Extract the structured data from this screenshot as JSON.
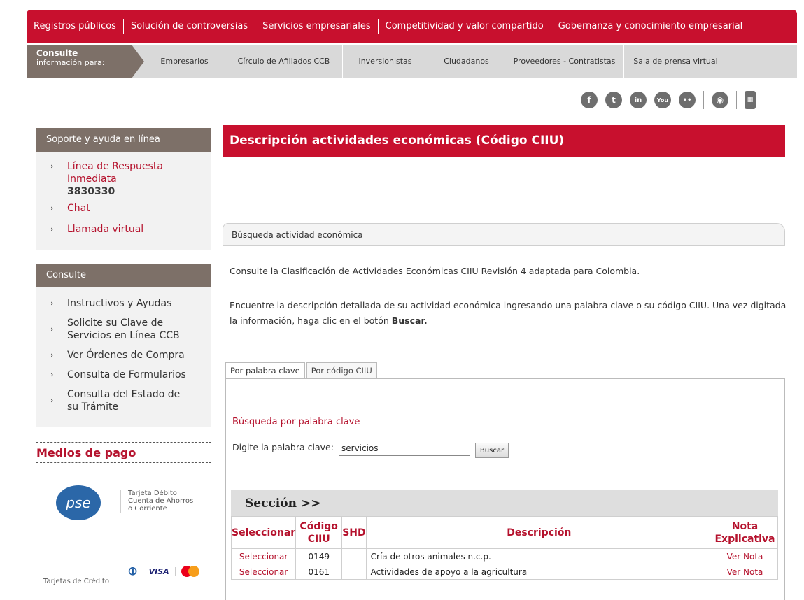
{
  "top_nav": [
    "Registros públicos",
    "Solución de controversias",
    "Servicios empresariales",
    "Competitividad y valor compartido",
    "Gobernanza y conocimiento empresarial"
  ],
  "sub_nav": {
    "consulte_title": "Consulte",
    "consulte_subtitle": "información para:",
    "items": [
      "Empresarios",
      "Círculo de Afiliados CCB",
      "Inversionistas",
      "Ciudadanos",
      "Proveedores - Contratistas",
      "Sala de prensa virtual"
    ]
  },
  "social": [
    {
      "icon": "facebook-icon",
      "glyph": "f"
    },
    {
      "icon": "twitter-icon",
      "glyph": "t"
    },
    {
      "icon": "linkedin-icon",
      "glyph": "in"
    },
    {
      "icon": "youtube-icon",
      "glyph": "You"
    },
    {
      "icon": "flickr-icon",
      "glyph": "••"
    },
    {
      "icon": "rss-icon",
      "glyph": "◉"
    },
    {
      "icon": "mobile-icon",
      "glyph": "▦"
    }
  ],
  "sidebar": {
    "support_title": "Soporte y ayuda en línea",
    "support_items": {
      "line_label": "Línea de Respuesta Inmediata",
      "line_number": "3830330",
      "chat": "Chat",
      "virtual_call": "Llamada virtual"
    },
    "consulte_title": "Consulte",
    "consulte_items": [
      "Instructivos y Ayudas",
      "Solicite su Clave de Servicios en Línea CCB",
      "Ver Órdenes de Compra",
      "Consulta de Formularios",
      "Consulta del Estado de su Trámite"
    ],
    "medios_title": "Medios de pago",
    "pse_logo": "pse",
    "pse_text": "Tarjeta Débito Cuenta de Ahorros o Corriente",
    "tarjetas_label": "Tarjetas de Crédito",
    "visa": "VISA"
  },
  "main": {
    "title": "Descripción actividades económicas (Código CIIU)",
    "search_header": "Búsqueda actividad económica",
    "para1": "Consulte la Clasificación de Actividades Económicas CIIU Revisión 4 adaptada para Colombia.",
    "para2_start": "Encuentre la descripción detallada de su actividad económica ingresando una palabra clave o su código CIIU. Una vez digitada la información, haga clic en el botón ",
    "para2_bold": "Buscar.",
    "tabs": [
      "Por palabra clave",
      "Por código CIIU"
    ],
    "search_title": "Búsqueda por palabra clave",
    "keyword_label": "Digite la palabra clave:",
    "keyword_value": "servicios",
    "search_button": "Buscar"
  },
  "results": {
    "section_label": "Sección >>",
    "headers": {
      "select": "Seleccionar",
      "code": "Código CIIU",
      "shd": "SHD",
      "desc": "Descripción",
      "note": "Nota Explicativa"
    },
    "rows": [
      {
        "select": "Seleccionar",
        "code": "0149",
        "shd": "",
        "desc": "Cría de otros animales n.c.p.",
        "note": "Ver Nota"
      },
      {
        "select": "Seleccionar",
        "code": "0161",
        "shd": "",
        "desc": "Actividades de apoyo a la agricultura",
        "note": "Ver Nota"
      }
    ]
  }
}
